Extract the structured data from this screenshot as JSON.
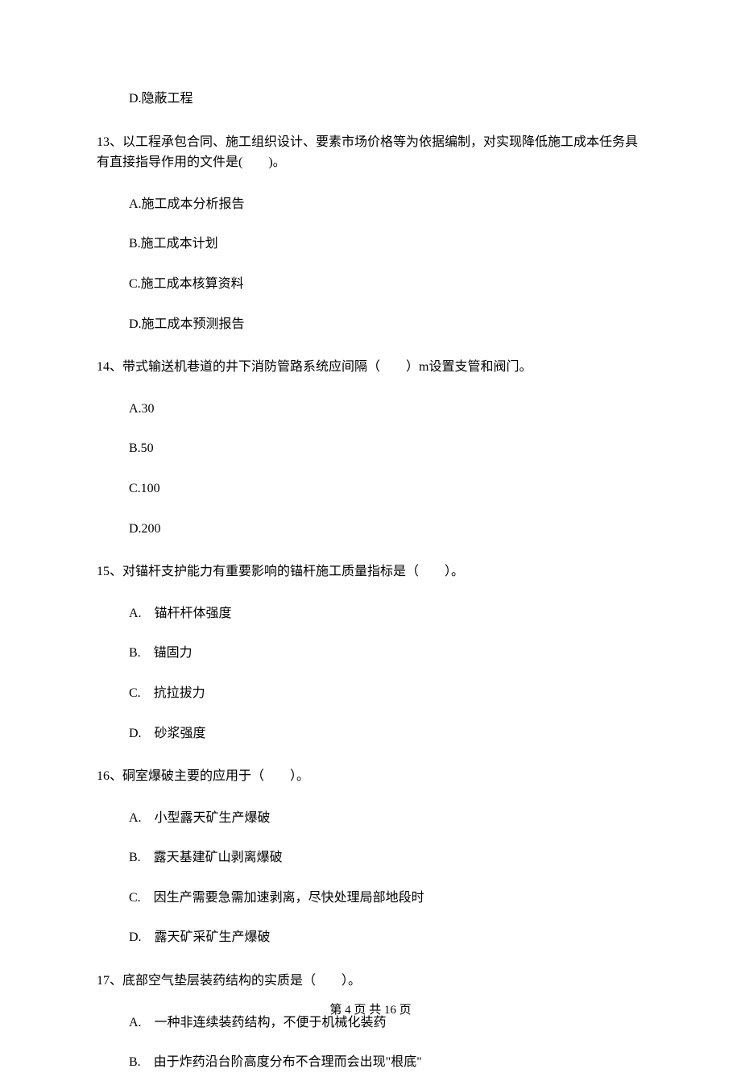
{
  "orphan_option": "D.隐蔽工程",
  "questions": [
    {
      "number": "13",
      "stem": "13、以工程承包合同、施工组织设计、要素市场价格等为依据编制，对实现降低施工成本任务具有直接指导作用的文件是(　　)。",
      "options": [
        "A.施工成本分析报告",
        "B.施工成本计划",
        "C.施工成本核算资料",
        "D.施工成本预测报告"
      ]
    },
    {
      "number": "14",
      "stem": "14、带式输送机巷道的井下消防管路系统应间隔（　　）m设置支管和阀门。",
      "options": [
        "A.30",
        "B.50",
        "C.100",
        "D.200"
      ]
    },
    {
      "number": "15",
      "stem": "15、对锚杆支护能力有重要影响的锚杆施工质量指标是（　　）。",
      "options": [
        "A.　锚杆杆体强度",
        "B.　锚固力",
        "C.　抗拉拔力",
        "D.　砂浆强度"
      ]
    },
    {
      "number": "16",
      "stem": "16、硐室爆破主要的应用于（　　）。",
      "options": [
        "A.　小型露天矿生产爆破",
        "B.　露天基建矿山剥离爆破",
        "C.　因生产需要急需加速剥离，尽快处理局部地段时",
        "D.　露天矿采矿生产爆破"
      ]
    },
    {
      "number": "17",
      "stem": "17、底部空气垫层装药结构的实质是（　　）。",
      "options": [
        "A.　一种非连续装药结构，不便于机械化装药",
        "B.　由于炸药沿台阶高度分布不合理而会出现\"根底\""
      ]
    }
  ],
  "footer": {
    "text": "第 4 页 共 16 页"
  }
}
